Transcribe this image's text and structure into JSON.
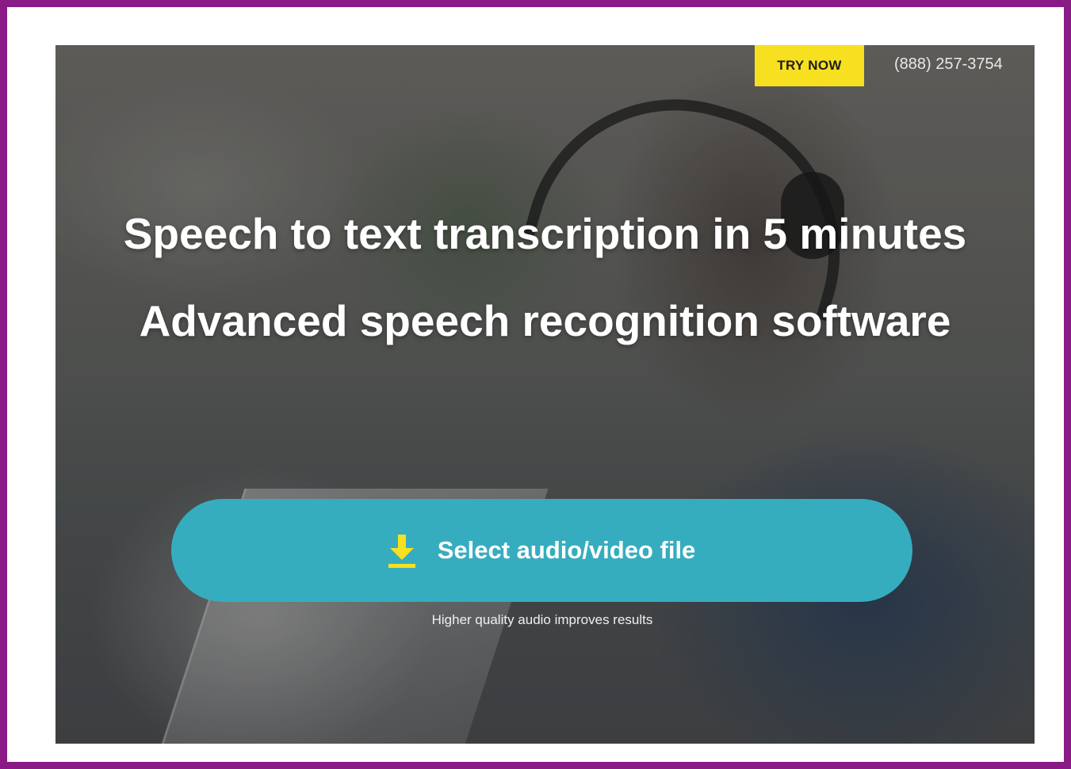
{
  "header": {
    "try_now_label": "TRY NOW",
    "phone": "(888) 257-3754"
  },
  "hero": {
    "headline_1": "Speech to text transcription in 5 minutes",
    "headline_2": "Advanced speech recognition software",
    "select_button_label": "Select audio/video file",
    "select_button_icon": "download-icon",
    "hint": "Higher quality audio improves results"
  },
  "colors": {
    "frame": "#8a1a86",
    "try_now_bg": "#f7e01f",
    "select_button_bg": "#36adbf",
    "download_icon": "#f7e01f"
  }
}
